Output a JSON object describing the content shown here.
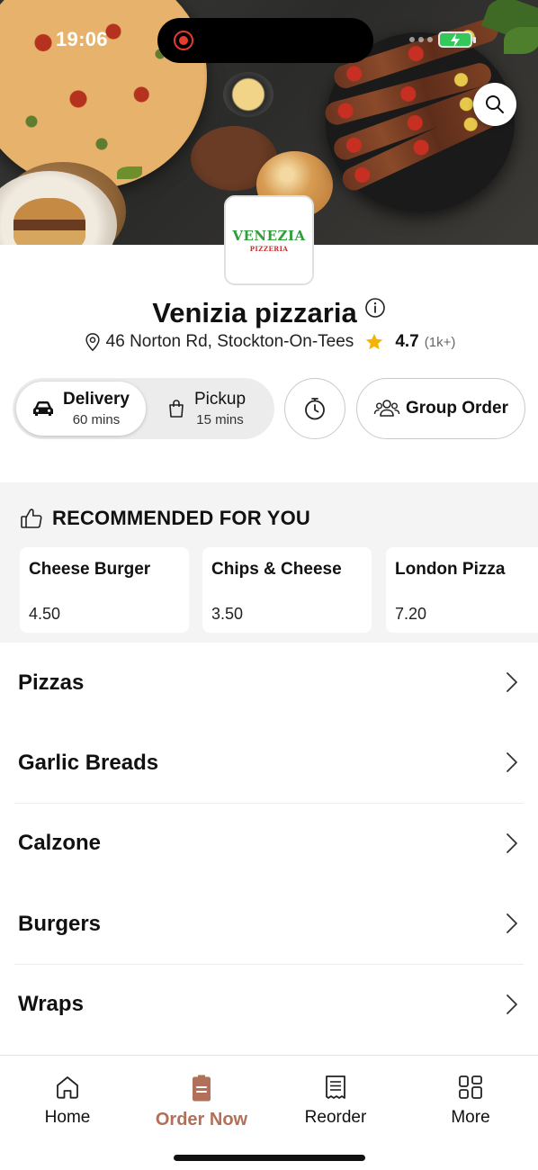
{
  "status_bar": {
    "time": "19:06"
  },
  "restaurant": {
    "logo_text": "VENEZIA",
    "logo_subtext": "PIZZERIA",
    "name": "Venizia pizzaria",
    "address": "46 Norton Rd, Stockton-On-Tees",
    "rating": "4.7",
    "rating_count": "(1k+)"
  },
  "order_mode": {
    "delivery": {
      "label": "Delivery",
      "time": "60 mins",
      "selected": true
    },
    "pickup": {
      "label": "Pickup",
      "time": "15 mins",
      "selected": false
    }
  },
  "group_order_label": "Group Order",
  "recommended": {
    "title": "RECOMMENDED FOR YOU",
    "items": [
      {
        "name": "Cheese Burger",
        "price": "4.50"
      },
      {
        "name": "Chips & Cheese",
        "price": "3.50"
      },
      {
        "name": "London Pizza",
        "price": "7.20"
      }
    ]
  },
  "categories": [
    "Pizzas",
    "Garlic Breads",
    "Calzone",
    "Burgers",
    "Wraps"
  ],
  "tab_bar": {
    "items": [
      {
        "label": "Home",
        "icon": "home-icon",
        "active": false
      },
      {
        "label": "Order Now",
        "icon": "order-bag-icon",
        "active": true
      },
      {
        "label": "Reorder",
        "icon": "receipt-icon",
        "active": false
      },
      {
        "label": "More",
        "icon": "grid-icon",
        "active": false
      }
    ]
  },
  "colors": {
    "accent": "#b0705a",
    "star": "#f4b400",
    "logo_green": "#2e9e3a",
    "logo_red": "#d02a2a",
    "battery_green": "#34c759",
    "recording_red": "#e83b2f"
  }
}
